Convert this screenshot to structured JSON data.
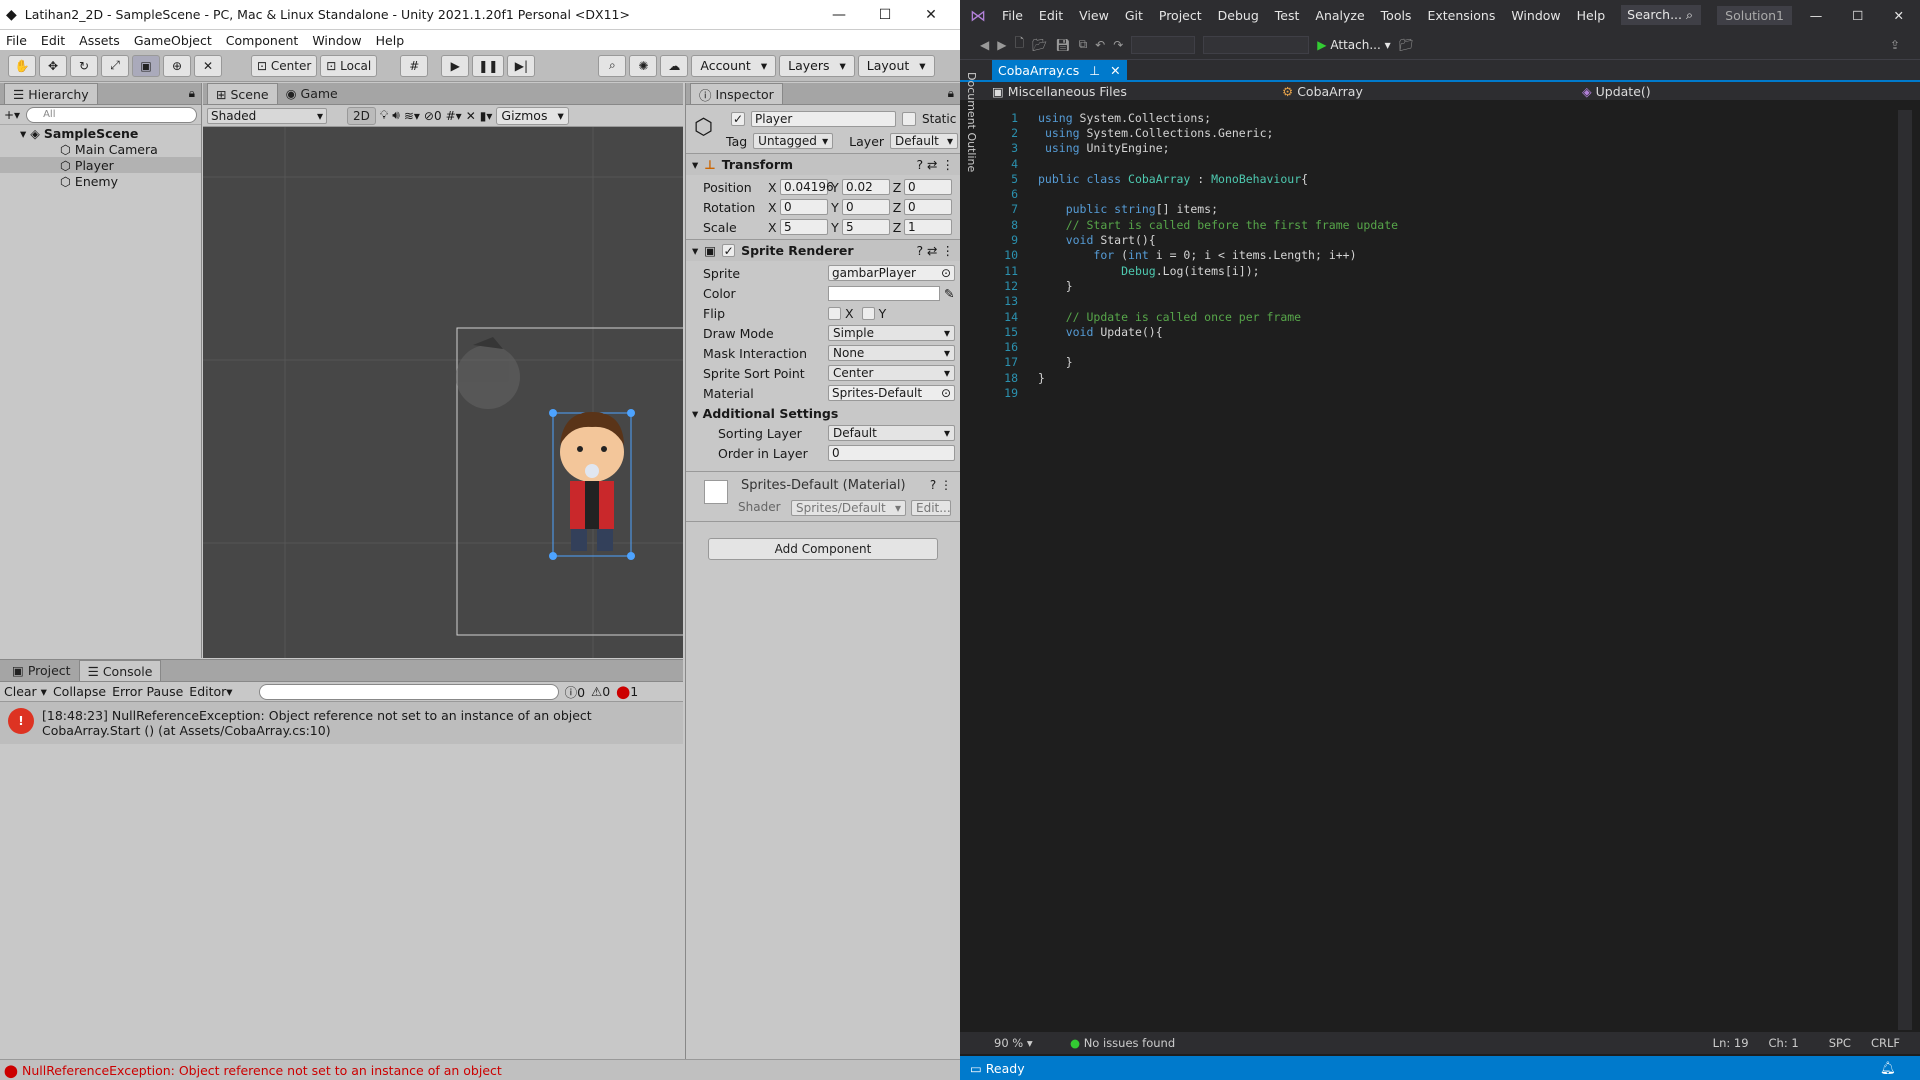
{
  "unity": {
    "title": "Latihan2_2D - SampleScene - PC, Mac & Linux Standalone - Unity 2021.1.20f1 Personal <DX11>",
    "window_buttons": [
      "—",
      "☐",
      "✕"
    ],
    "menu": [
      "File",
      "Edit",
      "Assets",
      "GameObject",
      "Component",
      "Window",
      "Help"
    ],
    "toolbar": {
      "center": "Center",
      "local": "Local",
      "account": "Account",
      "layers": "Layers",
      "layout": "Layout"
    },
    "hierarchy": {
      "tab": "Hierarchy",
      "search": "All",
      "scene": "SampleScene",
      "items": [
        "Main Camera",
        "Player",
        "Enemy"
      ]
    },
    "scene": {
      "tab_scene": "Scene",
      "tab_game": "Game",
      "shading": "Shaded",
      "mode_2d": "2D",
      "gizmos": "Gizmos",
      "hidden_count": "0"
    },
    "inspector": {
      "tab": "Inspector",
      "object_name": "Player",
      "static": "Static",
      "tag_label": "Tag",
      "tag": "Untagged",
      "layer_label": "Layer",
      "layer": "Default",
      "transform": {
        "title": "Transform",
        "position": {
          "label": "Position",
          "x": "0.04196",
          "y": "0.02",
          "z": "0"
        },
        "rotation": {
          "label": "Rotation",
          "x": "0",
          "y": "0",
          "z": "0"
        },
        "scale": {
          "label": "Scale",
          "x": "5",
          "y": "5",
          "z": "1"
        }
      },
      "sprite_renderer": {
        "title": "Sprite Renderer",
        "sprite_label": "Sprite",
        "sprite": "gambarPlayer",
        "color_label": "Color",
        "flip_label": "Flip",
        "flip_x": "X",
        "flip_y": "Y",
        "draw_mode_label": "Draw Mode",
        "draw_mode": "Simple",
        "mask_label": "Mask Interaction",
        "mask": "None",
        "sort_point_label": "Sprite Sort Point",
        "sort_point": "Center",
        "material_label": "Material",
        "material": "Sprites-Default",
        "additional": "Additional Settings",
        "sorting_layer_label": "Sorting Layer",
        "sorting_layer": "Default",
        "order_label": "Order in Layer",
        "order": "0"
      },
      "material": {
        "title": "Sprites-Default (Material)",
        "shader_label": "Shader",
        "shader": "Sprites/Default",
        "edit": "Edit..."
      },
      "add_component": "Add Component"
    },
    "console": {
      "tab_project": "Project",
      "tab_console": "Console",
      "buttons": {
        "clear": "Clear",
        "collapse": "Collapse",
        "error_pause": "Error Pause",
        "editor": "Editor"
      },
      "counts": {
        "info": "0",
        "warn": "0",
        "error": "1"
      },
      "entry_line1": "[18:48:23] NullReferenceException: Object reference not set to an instance of an object",
      "entry_line2": "CobaArray.Start () (at Assets/CobaArray.cs:10)"
    },
    "status": "NullReferenceException: Object reference not set to an instance of an object"
  },
  "vs": {
    "menu": [
      "File",
      "Edit",
      "View",
      "Git",
      "Project",
      "Debug",
      "Test",
      "Analyze",
      "Tools",
      "Extensions",
      "Window",
      "Help"
    ],
    "search": "Search...",
    "solution": "Solution1",
    "attach": "Attach...",
    "tab": "CobaArray.cs",
    "side_label": "Document Outline",
    "nav": {
      "scope": "Miscellaneous Files",
      "class": "CobaArray",
      "member": "Update()"
    },
    "code": [
      {
        "n": "1",
        "html": "<span class='kw'>using</span> System.Collections;"
      },
      {
        "n": "2",
        "html": " <span class='kw'>using</span> System.Collections.Generic;"
      },
      {
        "n": "3",
        "html": " <span class='kw'>using</span> UnityEngine;"
      },
      {
        "n": "4",
        "html": ""
      },
      {
        "n": "5",
        "html": "<span class='kw'>public class</span> <span class='ty'>CobaArray</span> : <span class='ty'>MonoBehaviour</span>{"
      },
      {
        "n": "6",
        "html": ""
      },
      {
        "n": "7",
        "html": "    <span class='kw'>public string</span>[] items;"
      },
      {
        "n": "8",
        "html": "    <span class='cm'>// Start is called before the first frame update</span>"
      },
      {
        "n": "9",
        "html": "    <span class='kw'>void</span> Start(){"
      },
      {
        "n": "10",
        "html": "        <span class='kw'>for</span> (<span class='kw'>int</span> i = 0; i &lt; items.Length; i++)"
      },
      {
        "n": "11",
        "html": "            <span class='ty'>Debug</span>.Log(items[i]);"
      },
      {
        "n": "12",
        "html": "    }"
      },
      {
        "n": "13",
        "html": ""
      },
      {
        "n": "14",
        "html": "    <span class='cm'>// Update is called once per frame</span>"
      },
      {
        "n": "15",
        "html": "    <span class='kw'>void</span> Update(){"
      },
      {
        "n": "16",
        "html": ""
      },
      {
        "n": "17",
        "html": "    }"
      },
      {
        "n": "18",
        "html": "}"
      },
      {
        "n": "19",
        "html": ""
      }
    ],
    "bottom": {
      "zoom": "90 %",
      "issues": "No issues found",
      "ln": "Ln: 19",
      "ch": "Ch: 1",
      "spc": "SPC",
      "crlf": "CRLF"
    },
    "status": "Ready"
  }
}
